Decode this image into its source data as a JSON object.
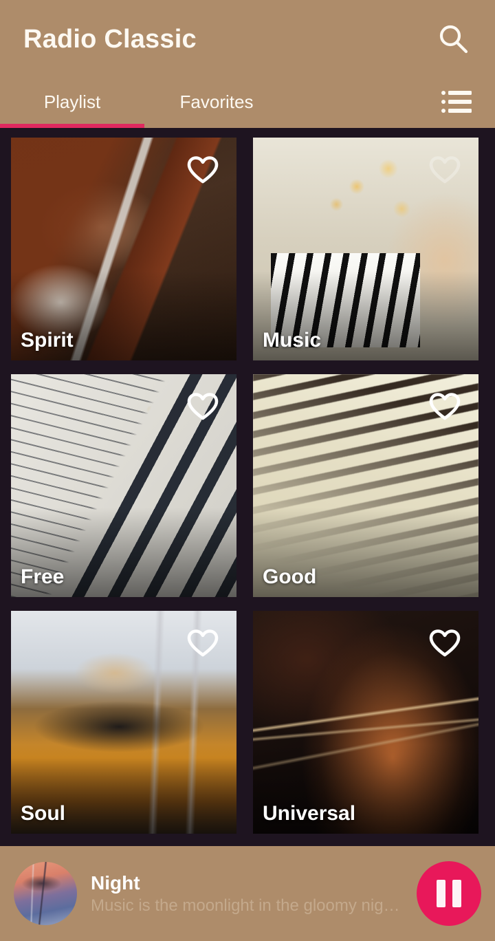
{
  "header": {
    "title": "Radio Classic",
    "search_icon": "search-icon",
    "list_icon": "list-view-icon"
  },
  "tabs": {
    "items": [
      {
        "label": "Playlist",
        "active": true
      },
      {
        "label": "Favorites",
        "active": false
      }
    ],
    "indicator_color": "#e0295f"
  },
  "colors": {
    "header_background": "#ae8c6a",
    "page_background": "#1e1420",
    "accent": "#e0295f",
    "play_button": "#e8185a",
    "title_text": "#ffffff",
    "subtitle_text": "#c4a98c"
  },
  "grid": {
    "cards": [
      {
        "title": "Spirit",
        "favorite_icon": "heart-outline-icon",
        "favorited": false,
        "art": "violin-being-played"
      },
      {
        "title": "Music",
        "favorite_icon": "heart-outline-icon",
        "favorited": false,
        "art": "child-playing-piano"
      },
      {
        "title": "Free",
        "favorite_icon": "heart-outline-icon",
        "favorited": false,
        "art": "piano-keys-sheet-music"
      },
      {
        "title": "Good",
        "favorite_icon": "heart-outline-icon",
        "favorited": false,
        "art": "piano-keyboard-sepia"
      },
      {
        "title": "Soul",
        "favorite_icon": "heart-outline-icon",
        "favorited": false,
        "art": "violin-body-closeup"
      },
      {
        "title": "Universal",
        "favorite_icon": "heart-outline-icon",
        "favorited": false,
        "art": "cello-dark-background"
      }
    ]
  },
  "player": {
    "thumbnail": "album-art-thumbnail",
    "title": "Night",
    "subtitle": "Music is the moonlight in the gloomy night ...",
    "control_icon": "pause-icon",
    "state": "playing"
  }
}
